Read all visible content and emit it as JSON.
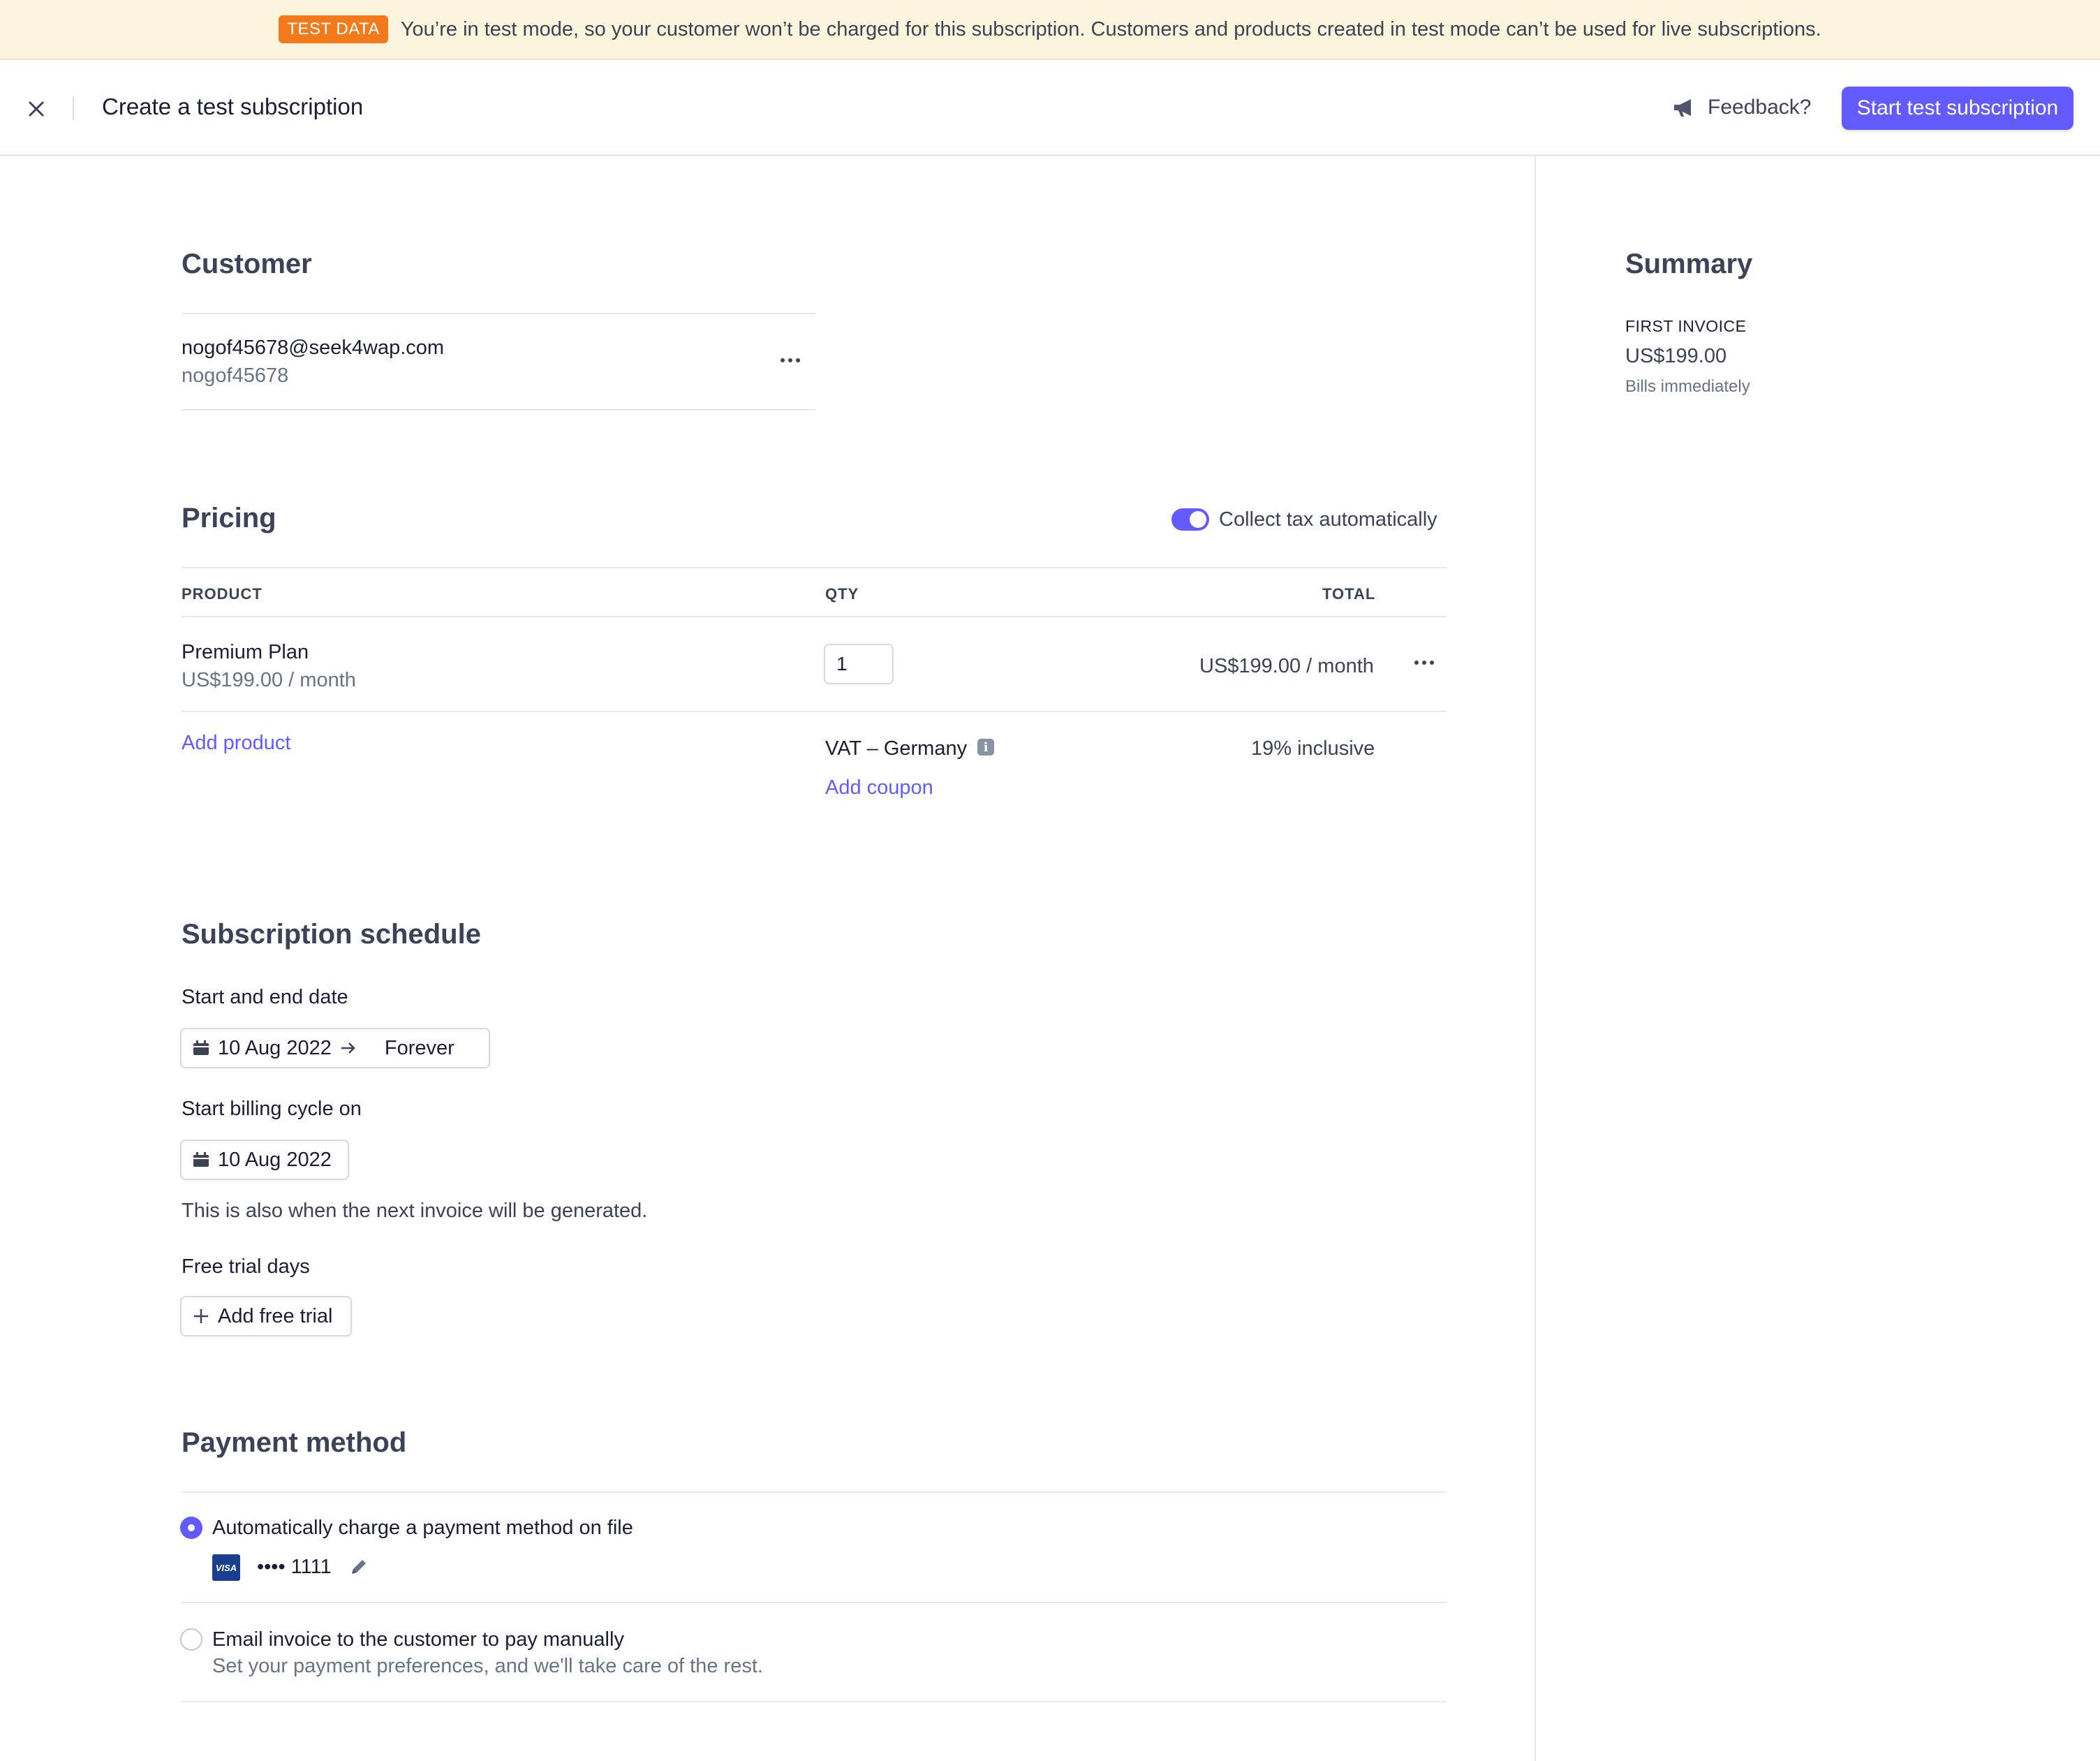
{
  "banner": {
    "badge": "TEST DATA",
    "message": "You’re in test mode, so your customer won’t be charged for this subscription. Customers and products created in test mode can’t be used for live subscriptions."
  },
  "header": {
    "title": "Create a test subscription",
    "feedback": "Feedback?",
    "primary_button": "Start test subscription"
  },
  "customer": {
    "heading": "Customer",
    "email": "nogof45678@seek4wap.com",
    "name": "nogof45678"
  },
  "pricing": {
    "heading": "Pricing",
    "tax_toggle_label": "Collect tax automatically",
    "tax_toggle_on": true,
    "columns": {
      "product": "PRODUCT",
      "qty": "QTY",
      "total": "TOTAL"
    },
    "items": [
      {
        "name": "Premium Plan",
        "price": "US$199.00 / month",
        "qty": "1",
        "total": "US$199.00 / month"
      }
    ],
    "add_product": "Add product",
    "tax_name": "VAT – Germany",
    "tax_value": "19% inclusive",
    "add_coupon": "Add coupon"
  },
  "schedule": {
    "heading": "Subscription schedule",
    "dates_label": "Start and end date",
    "start_date": "10 Aug 2022",
    "end_date": "Forever",
    "billing_label": "Start billing cycle on",
    "billing_date": "10 Aug 2022",
    "billing_help": "This is also when the next invoice will be generated.",
    "trial_label": "Free trial days",
    "trial_button": "Add free trial"
  },
  "payment": {
    "heading": "Payment method",
    "option_auto": "Automatically charge a payment method on file",
    "card_brand": "VISA",
    "card_masked": "•••• 1111",
    "option_email": "Email invoice to the customer to pay manually",
    "option_email_help": "Set your payment preferences, and we'll take care of the rest.",
    "selected": "auto"
  },
  "summary": {
    "heading": "Summary",
    "invoice_label": "FIRST INVOICE",
    "invoice_amount": "US$199.00",
    "invoice_note": "Bills immediately"
  },
  "icons": {
    "close": "close-icon",
    "feedback": "megaphone-icon",
    "more": "more-dots-icon",
    "info": "info-icon",
    "calendar": "calendar-icon",
    "arrow": "arrow-right-icon",
    "plus": "plus-icon",
    "edit": "pencil-icon"
  },
  "colors": {
    "accent": "#635bff",
    "banner_bg": "#fcf5dc",
    "badge": "#f27a1a"
  }
}
